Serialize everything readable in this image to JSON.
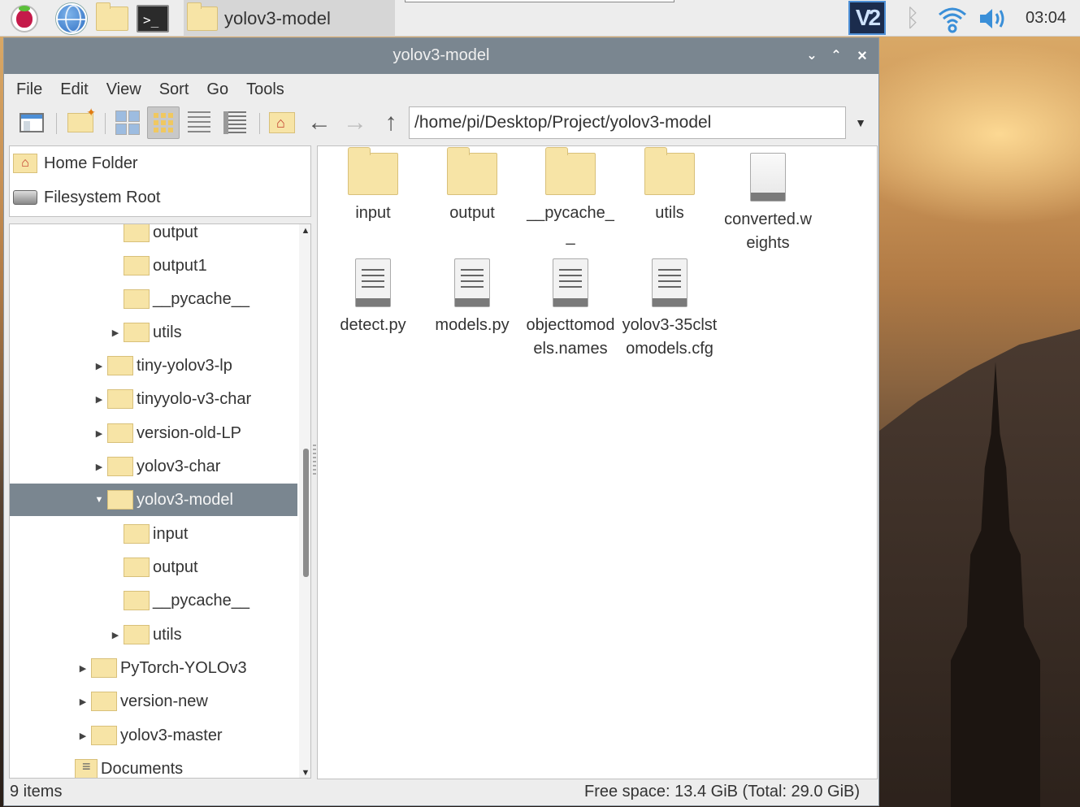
{
  "taskbar": {
    "task_title": "yolov3-model",
    "clock": "03:04",
    "vnc_label": "V2"
  },
  "window": {
    "title": "yolov3-model",
    "menu": [
      "File",
      "Edit",
      "View",
      "Sort",
      "Go",
      "Tools"
    ],
    "path": "/home/pi/Desktop/Project/yolov3-model"
  },
  "places": [
    {
      "label": "Home Folder",
      "icon": "home-folder-icon"
    },
    {
      "label": "Filesystem Root",
      "icon": "drive-icon"
    }
  ],
  "tree": [
    {
      "label": "output",
      "expander": ""
    },
    {
      "label": "output1",
      "expander": ""
    },
    {
      "label": "__pycache__",
      "expander": ""
    },
    {
      "label": "utils",
      "expander": "▶"
    },
    {
      "label": "tiny-yolov3-lp",
      "expander": "▶"
    },
    {
      "label": "tinyyolo-v3-char",
      "expander": "▶"
    },
    {
      "label": "version-old-LP",
      "expander": "▶"
    },
    {
      "label": "yolov3-char",
      "expander": "▶"
    },
    {
      "label": "yolov3-model",
      "expander": "▼",
      "selected": true
    },
    {
      "label": "input",
      "expander": ""
    },
    {
      "label": "output",
      "expander": ""
    },
    {
      "label": "__pycache__",
      "expander": ""
    },
    {
      "label": "utils",
      "expander": "▶"
    },
    {
      "label": "PyTorch-YOLOv3",
      "expander": "▶"
    },
    {
      "label": "version-new",
      "expander": "▶"
    },
    {
      "label": "yolov3-master",
      "expander": "▶"
    },
    {
      "label": "Documents",
      "expander": ""
    }
  ],
  "files": [
    {
      "name": "input",
      "kind": "folder"
    },
    {
      "name": "output",
      "kind": "folder"
    },
    {
      "name": "__pycache__",
      "kind": "folder"
    },
    {
      "name": "utils",
      "kind": "folder"
    },
    {
      "name": "converted.weights",
      "kind": "file"
    },
    {
      "name": "detect.py",
      "kind": "text"
    },
    {
      "name": "models.py",
      "kind": "text"
    },
    {
      "name": "objecttomodels.names",
      "kind": "text"
    },
    {
      "name": "yolov3-35clstomodels.cfg",
      "kind": "text"
    }
  ],
  "status": {
    "items": "9 items",
    "free_space": "Free space: 13.4 GiB (Total: 29.0 GiB)"
  }
}
